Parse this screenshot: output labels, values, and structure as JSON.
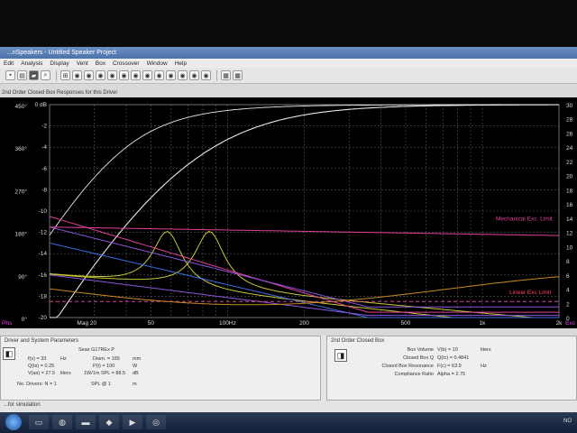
{
  "window": {
    "title": "...nSpeakers - Untitled Speaker Project"
  },
  "menu": [
    "Edit",
    "Analysis",
    "Display",
    "Vent",
    "Box",
    "Crossover",
    "Window",
    "Help"
  ],
  "toolbar": {
    "icons": [
      "save-icon",
      "print-icon",
      "zoom-icon",
      "chart-icon",
      "target-icon"
    ]
  },
  "graph": {
    "title": "2nd Order Closed Box Responses for this Driver",
    "left_axis_deg": [
      "450°",
      "360°",
      "270°",
      "180°",
      "90°",
      "0°"
    ],
    "left_axis_db": [
      "0 dB",
      "-2",
      "-4",
      "-6",
      "-8",
      "-10",
      "-12",
      "-14",
      "-16",
      "-18",
      "-20"
    ],
    "right_axis": [
      "30",
      "28",
      "26",
      "24",
      "22",
      "20",
      "18",
      "16",
      "14",
      "12",
      "10",
      "8",
      "6",
      "4",
      "2",
      "0"
    ],
    "x_labels": [
      "Mag 20",
      "50",
      "100Hz",
      "200",
      "500",
      "1k",
      "2k"
    ],
    "corner_left": "Phs",
    "corner_right": "Exc",
    "annotations": [
      "Mechanical Exc. Limit",
      "Linear Exc Limit"
    ],
    "colors": {
      "mag": "#e8e8e8",
      "excursion": "#c8c838",
      "limit": "#e0409a",
      "group": "#8a55e0",
      "blue": "#3c6ee6"
    }
  },
  "driver_panel": {
    "title": "Driver and System Parameters",
    "driver": "Seas G17REx P",
    "left": [
      [
        "f(s) = 33",
        "Hz"
      ],
      [
        "Q(ts) = 0.25",
        ""
      ],
      [
        "V(as) = 27.5",
        "liters"
      ]
    ],
    "right": [
      [
        "Diam. = 165",
        "mm"
      ],
      [
        "P(t) = 100",
        "W"
      ],
      [
        "1W/1m SPL = 88.5",
        "dB"
      ]
    ],
    "drivers": "No. Drivers:   N = 1",
    "spl": "SPL @ 1",
    "spl_unit": "m"
  },
  "box_panel": {
    "title": "2nd Order Closed Box",
    "rows": [
      [
        "Box Volume",
        "V(b) = 10",
        "liters"
      ],
      [
        "Closed Box Q",
        "Q(tc) = 0.4841",
        ""
      ],
      [
        "Closed Box Resonance",
        "F(c) = 63.9",
        "Hz"
      ],
      [
        "Compliance Ratio",
        "Alpha = 2.75",
        ""
      ]
    ]
  },
  "status": "...for simulation",
  "taskbar": {
    "tray": "NO"
  }
}
